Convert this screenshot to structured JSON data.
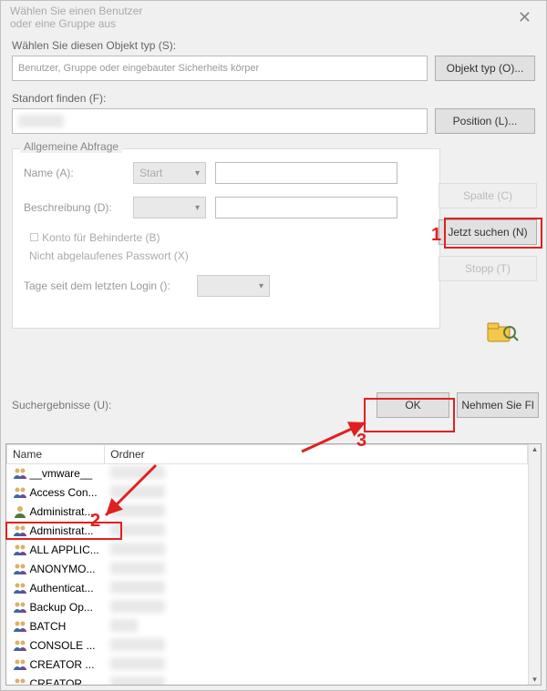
{
  "title_line1": "Wählen Sie einen Benutzer",
  "title_line2": "oder eine Gruppe aus",
  "sections": {
    "object_type_label": "Wählen Sie diesen Objekt typ (S):",
    "object_type_value": "Benutzer, Gruppe oder eingebauter Sicherheits körper",
    "object_type_button": "Objekt typ (O)...",
    "location_label": "Standort finden (F):",
    "location_button": "Position (L)..."
  },
  "query": {
    "tab": "Allgemeine Abfrage",
    "name_label": "Name (A):",
    "name_option": "Start",
    "desc_label": "Beschreibung (D):",
    "check_disabled": "Konto für Behinderte (B)",
    "check_pw": "Nicht abgelaufenes Passwort (X)",
    "days_label": "Tage seit dem letzten Login ():"
  },
  "right_buttons": {
    "columns": "Spalte (C)",
    "search": "Jetzt suchen (N)",
    "stop": "Stopp (T)"
  },
  "bottom": {
    "results_label": "Suchergebnisse (U):",
    "ok": "OK",
    "cancel": "Nehmen Sie Fl"
  },
  "columns": {
    "name": "Name",
    "folder": "Ordner"
  },
  "rows": [
    {
      "icon": "group",
      "name": "__vmware__",
      "folder": ""
    },
    {
      "icon": "group",
      "name": "Access Con...",
      "folder": ""
    },
    {
      "icon": "user",
      "name": "Administrat...",
      "folder": ""
    },
    {
      "icon": "group",
      "name": "Administrat...",
      "folder": ""
    },
    {
      "icon": "group",
      "name": "ALL APPLIC...",
      "folder": ""
    },
    {
      "icon": "group",
      "name": "ANONYMO...",
      "folder": ""
    },
    {
      "icon": "group",
      "name": "Authenticat...",
      "folder": ""
    },
    {
      "icon": "group",
      "name": "Backup Op...",
      "folder": ""
    },
    {
      "icon": "group",
      "name": "BATCH",
      "folder": ""
    },
    {
      "icon": "group",
      "name": "CONSOLE ...",
      "folder": ""
    },
    {
      "icon": "group",
      "name": "CREATOR ...",
      "folder": ""
    },
    {
      "icon": "group",
      "name": "CREATOR ...",
      "folder": ""
    }
  ],
  "annotations": {
    "n1": "1",
    "n2": "2",
    "n3": "3"
  }
}
